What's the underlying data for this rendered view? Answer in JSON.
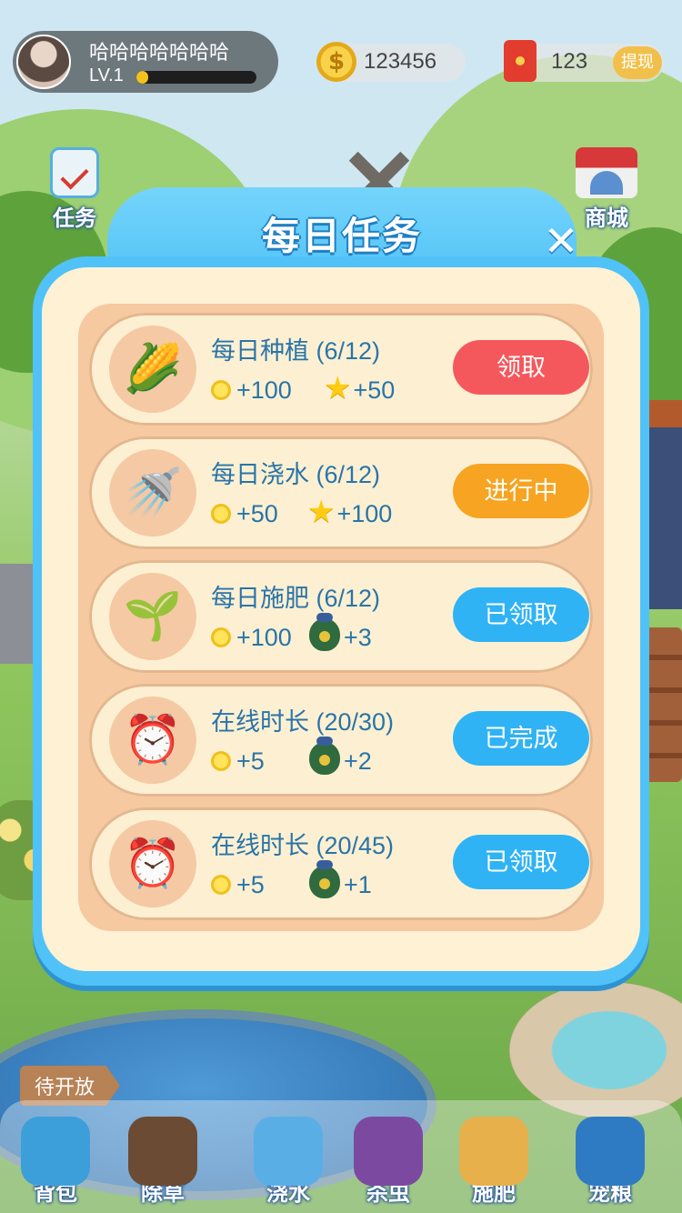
{
  "header": {
    "nickname": "哈哈哈哈哈哈哈",
    "level": "LV.1",
    "xp_progress": 0.1,
    "coins": "123456",
    "red_packet": "123",
    "withdraw_label": "提现"
  },
  "side": {
    "task_label": "任务",
    "shop_label": "商城"
  },
  "modal": {
    "title": "每日任务",
    "close_label": "✕",
    "tasks": [
      {
        "icon": "corn-icon",
        "title": "每日种植 (6/12)",
        "reward1": "+100",
        "reward1_type": "coin",
        "reward2": "+50",
        "reward2_type": "star",
        "action": "领取",
        "action_color": "#f5585c"
      },
      {
        "icon": "watering-can-icon",
        "title": "每日浇水 (6/12)",
        "reward1": "+50",
        "reward1_type": "coin",
        "reward2": "+100",
        "reward2_type": "star",
        "action": "进行中",
        "action_color": "#f6a421"
      },
      {
        "icon": "fertilizer-bag-icon",
        "title": "每日施肥 (6/12)",
        "reward1": "+100",
        "reward1_type": "coin",
        "reward2": "+3",
        "reward2_type": "seed-bag",
        "action": "已领取",
        "action_color": "#2fb3f4"
      },
      {
        "icon": "alarm-clock-icon",
        "title": "在线时长 (20/30)",
        "reward1": "+5",
        "reward1_type": "coin",
        "reward2": "+2",
        "reward2_type": "seed-bag",
        "action": "已完成",
        "action_color": "#2fb3f4"
      },
      {
        "icon": "alarm-clock-icon",
        "title": "在线时长 (20/45)",
        "reward1": "+5",
        "reward1_type": "coin",
        "reward2": "+1",
        "reward2_type": "seed-bag",
        "action": "已领取",
        "action_color": "#2fb3f4"
      }
    ]
  },
  "signpost_label": "待开放",
  "dock": [
    {
      "icon": "backpack-icon",
      "label": "背包"
    },
    {
      "icon": "shovel-icon",
      "label": "除草"
    },
    {
      "icon": "watering-can-icon",
      "label": "浇水"
    },
    {
      "icon": "pesticide-icon",
      "label": "杀虫"
    },
    {
      "icon": "fertilizer-icon",
      "label": "施肥"
    },
    {
      "icon": "pet-food-icon",
      "label": "宠粮"
    }
  ]
}
